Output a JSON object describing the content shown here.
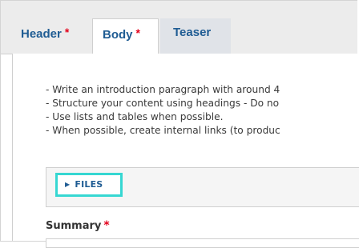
{
  "tabs": [
    {
      "label": "Header",
      "required": "*"
    },
    {
      "label": "Body",
      "required": "*"
    },
    {
      "label": "Teaser"
    }
  ],
  "hints": [
    "- Write an introduction paragraph with around 4",
    "- Structure your content using headings - Do no",
    "- Use lists and tables when possible.",
    "- When possible, create internal links (to produc"
  ],
  "files": {
    "label": "FILES",
    "icon": "triangle-right-icon"
  },
  "summary": {
    "label": "Summary",
    "required": "*"
  },
  "colors": {
    "tab_link": "#1f5c93",
    "required": "#e3001b",
    "highlight": "#36d7d2"
  }
}
